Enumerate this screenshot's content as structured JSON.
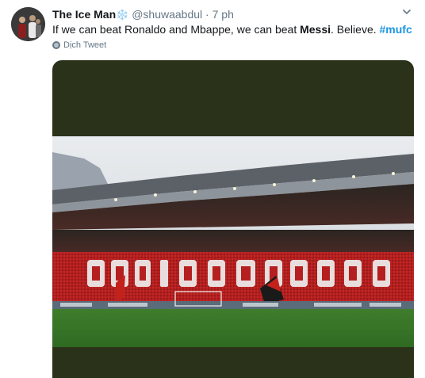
{
  "tweet": {
    "display_name": "The Ice Man",
    "name_emoji": "❄️",
    "handle": "@shuwaabdul",
    "separator": "·",
    "time": "7 ph",
    "text_part1": "If we can beat Ronaldo and Mbappe, we can beat ",
    "text_bold": "Messi",
    "text_part2": ". Believe. ",
    "hashtag": "#mufc",
    "translate_label": "Dịch Tweet",
    "menu_icon": "chevron-down-icon"
  },
  "colors": {
    "accent": "#1b95e0",
    "muted": "#657786",
    "media_bg": "#2a3219"
  }
}
